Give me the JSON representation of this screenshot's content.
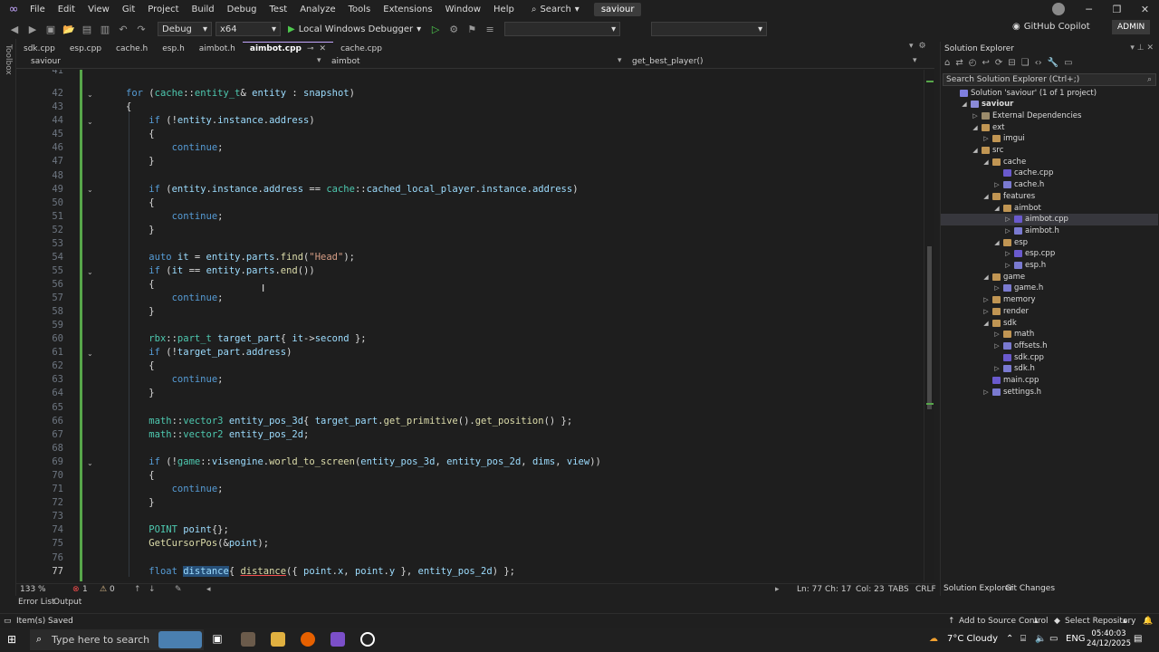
{
  "menubar": {
    "items": [
      "File",
      "Edit",
      "View",
      "Git",
      "Project",
      "Build",
      "Debug",
      "Test",
      "Analyze",
      "Tools",
      "Extensions",
      "Window",
      "Help"
    ],
    "search_label": "Search",
    "solution_name": "saviour"
  },
  "toolbar": {
    "config": "Debug",
    "platform": "x64",
    "run_label": "Local Windows Debugger",
    "copilot_label": "GitHub Copilot",
    "admin_label": "ADMIN"
  },
  "toolbox_label": "Toolbox",
  "tabs": [
    {
      "label": "sdk.cpp",
      "active": false
    },
    {
      "label": "esp.cpp",
      "active": false
    },
    {
      "label": "cache.h",
      "active": false
    },
    {
      "label": "esp.h",
      "active": false
    },
    {
      "label": "aimbot.h",
      "active": false
    },
    {
      "label": "aimbot.cpp",
      "active": true
    },
    {
      "label": "cache.cpp",
      "active": false
    }
  ],
  "navbar": {
    "project": "saviour",
    "scope": "aimbot",
    "member": "get_best_player()"
  },
  "editor": {
    "line_numbers": [
      "41",
      "42",
      "43",
      "44",
      "45",
      "46",
      "47",
      "48",
      "49",
      "50",
      "51",
      "52",
      "53",
      "54",
      "55",
      "56",
      "57",
      "58",
      "59",
      "60",
      "61",
      "62",
      "63",
      "64",
      "65",
      "66",
      "67",
      "68",
      "69",
      "70",
      "71",
      "72",
      "73",
      "74",
      "75",
      "76",
      "77"
    ],
    "current_line": "77"
  },
  "editor_status": {
    "zoom": "133 %",
    "errors": "1",
    "warnings": "0",
    "ln": "Ln: 77",
    "ch": "Ch: 17",
    "col": "Col: 23",
    "indent": "TABS",
    "eol": "CRLF"
  },
  "panel_tabs": [
    "Error List",
    "Output"
  ],
  "solution_explorer": {
    "title": "Solution Explorer",
    "search_placeholder": "Search Solution Explorer (Ctrl+;)",
    "tree": [
      {
        "label": "Solution 'saviour' (1 of 1 project)",
        "depth": 0,
        "icon": "sol",
        "tw": ""
      },
      {
        "label": "saviour",
        "depth": 1,
        "icon": "proj",
        "tw": "◢",
        "bold": true
      },
      {
        "label": "External Dependencies",
        "depth": 2,
        "icon": "dep",
        "tw": "▷"
      },
      {
        "label": "ext",
        "depth": 2,
        "icon": "folder",
        "tw": "◢"
      },
      {
        "label": "imgui",
        "depth": 3,
        "icon": "folder",
        "tw": "▷"
      },
      {
        "label": "src",
        "depth": 2,
        "icon": "folder",
        "tw": "◢"
      },
      {
        "label": "cache",
        "depth": 3,
        "icon": "folder",
        "tw": "◢"
      },
      {
        "label": "cache.cpp",
        "depth": 4,
        "icon": "cpp",
        "tw": ""
      },
      {
        "label": "cache.h",
        "depth": 4,
        "icon": "h",
        "tw": "▷"
      },
      {
        "label": "features",
        "depth": 3,
        "icon": "folder",
        "tw": "◢"
      },
      {
        "label": "aimbot",
        "depth": 4,
        "icon": "folder",
        "tw": "◢"
      },
      {
        "label": "aimbot.cpp",
        "depth": 5,
        "icon": "cpp",
        "tw": "▷",
        "selected": true
      },
      {
        "label": "aimbot.h",
        "depth": 5,
        "icon": "h",
        "tw": "▷"
      },
      {
        "label": "esp",
        "depth": 4,
        "icon": "folder",
        "tw": "◢"
      },
      {
        "label": "esp.cpp",
        "depth": 5,
        "icon": "cpp",
        "tw": "▷"
      },
      {
        "label": "esp.h",
        "depth": 5,
        "icon": "h",
        "tw": "▷"
      },
      {
        "label": "game",
        "depth": 3,
        "icon": "folder",
        "tw": "◢"
      },
      {
        "label": "game.h",
        "depth": 4,
        "icon": "h",
        "tw": "▷"
      },
      {
        "label": "memory",
        "depth": 3,
        "icon": "folder",
        "tw": "▷"
      },
      {
        "label": "render",
        "depth": 3,
        "icon": "folder",
        "tw": "▷"
      },
      {
        "label": "sdk",
        "depth": 3,
        "icon": "folder",
        "tw": "◢"
      },
      {
        "label": "math",
        "depth": 4,
        "icon": "folder",
        "tw": "▷"
      },
      {
        "label": "offsets.h",
        "depth": 4,
        "icon": "h",
        "tw": "▷"
      },
      {
        "label": "sdk.cpp",
        "depth": 4,
        "icon": "cpp",
        "tw": ""
      },
      {
        "label": "sdk.h",
        "depth": 4,
        "icon": "h",
        "tw": "▷"
      },
      {
        "label": "main.cpp",
        "depth": 3,
        "icon": "cpp",
        "tw": ""
      },
      {
        "label": "settings.h",
        "depth": 3,
        "icon": "h",
        "tw": "▷"
      }
    ],
    "bottom_tabs": [
      "Solution Explorer",
      "Git Changes"
    ]
  },
  "statusbar": {
    "message": "Item(s) Saved",
    "source_control": "Add to Source Control",
    "repository": "Select Repository"
  },
  "taskbar": {
    "search_placeholder": "Type here to search",
    "weather": "7°C  Cloudy",
    "language": "ENG",
    "time": "05:40:03",
    "date": "24/12/2025"
  }
}
